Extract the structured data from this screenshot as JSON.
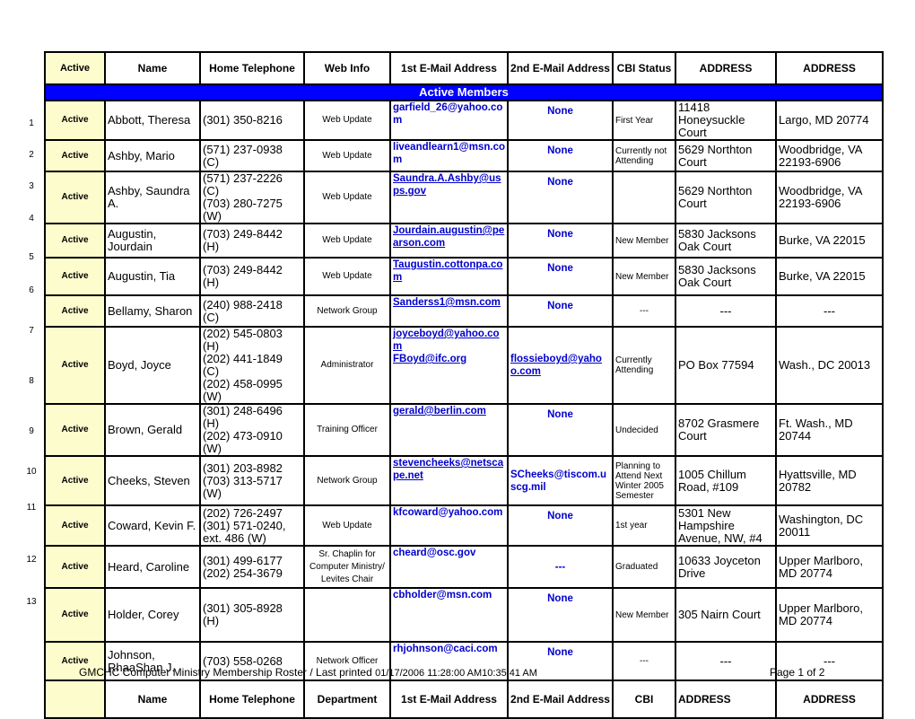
{
  "header": {
    "active": "Active",
    "name": "Name",
    "home_telephone": "Home Telephone",
    "web_info": "Web Info",
    "email1": "1st E-Mail Address",
    "email2": "2nd E-Mail Address",
    "cbi_status": "CBI Status",
    "address1": "ADDRESS",
    "address2": "ADDRESS"
  },
  "section_title": "Active Members",
  "rows": [
    {
      "num": "1",
      "active": "Active",
      "name": "Abbott, Theresa",
      "phone": "(301) 350-8216",
      "web": "Web Update",
      "email1": "garfield_26@yahoo.com",
      "email2": "None",
      "cbi": "First Year",
      "address1": "11418 Honeysuckle Court",
      "address2": "Largo, MD  20774"
    },
    {
      "num": "2",
      "active": "Active",
      "name": "Ashby, Mario",
      "phone": "(571) 237-0938 (C)",
      "web": "Web Update",
      "email1": "liveandlearn1@msn.com",
      "email2": "None",
      "cbi": "Currently not Attending",
      "address1": "5629 Northton Court",
      "address2": "Woodbridge, VA 22193-6906"
    },
    {
      "num": "3",
      "active": "Active",
      "name": "Ashby, Saundra A.",
      "phone": "(571) 237-2226 (C)\n(703) 280-7275 (W)",
      "web": "Web Update",
      "email1": "Saundra.A.Ashby@usps.gov",
      "email2": "None",
      "cbi": "",
      "address1": "5629 Northton Court",
      "address2": "Woodbridge, VA 22193-6906"
    },
    {
      "num": "4",
      "active": "Active",
      "name": "Augustin, Jourdain",
      "phone": "(703) 249-8442 (H)",
      "web": "Web Update",
      "email1": "Jourdain.augustin@pearson.com",
      "email2": "None",
      "cbi": "New Member",
      "address1": "5830 Jacksons Oak Court",
      "address2": "Burke, VA 22015"
    },
    {
      "num": "5",
      "active": "Active",
      "name": "Augustin, Tia",
      "phone": "(703) 249-8442 (H)",
      "web": "Web Update",
      "email1": "Taugustin.cottonpa.com",
      "email2": "None",
      "cbi": "New Member",
      "address1": "5830 Jacksons Oak Court",
      "address2": "Burke, VA 22015"
    },
    {
      "num": "6",
      "active": "Active",
      "name": "Bellamy, Sharon",
      "phone": "(240) 988-2418 (C)",
      "web": "Network Group",
      "email1": "Sanderss1@msn.com",
      "email2": "None",
      "cbi": "---",
      "address1": "---",
      "address2": "---"
    },
    {
      "num": "7",
      "active": "Active",
      "name": "Boyd, Joyce",
      "phone": "(202) 545-0803 (H)\n(202) 441-1849 (C)\n(202) 458-0995 (W)",
      "web": "Administrator",
      "email1": "joyceboyd@yahoo.com",
      "email1b": "FBoyd@ifc.org",
      "email2": "flossieboyd@yahoo.com",
      "cbi": "Currently Attending",
      "address1": "PO Box 77594",
      "address2": "Wash., DC 20013"
    },
    {
      "num": "8",
      "active": "Active",
      "name": "Brown, Gerald",
      "phone": "(301) 248-6496 (H)\n(202) 473-0910 (W)",
      "web": "Training Officer",
      "email1": "gerald@berlin.com",
      "email2": "None",
      "cbi": "Undecided",
      "address1": "8702 Grasmere Court",
      "address2": "Ft. Wash., MD 20744"
    },
    {
      "num": "9",
      "active": "Active",
      "name": "Cheeks, Steven",
      "phone": "(301) 203-8982\n(703) 313-5717 (W)",
      "web": "Network Group",
      "email1": "stevencheeks@netscape.net",
      "email2": "SCheeks@tiscom.uscg.mil",
      "cbi": "Planning to Attend Next Winter 2005 Semester",
      "address1": "1005 Chillum Road, #109",
      "address2": "Hyattsville, MD 20782"
    },
    {
      "num": "10",
      "active": "Active",
      "name": "Coward, Kevin F.",
      "phone": "(202) 726-2497\n(301) 571-0240, ext. 486 (W)",
      "web": "Web Update",
      "email1": "kfcoward@yahoo.com",
      "email2": "None",
      "cbi": "1st year",
      "address1": "5301 New Hampshire Avenue, NW, #4",
      "address2": "Washington, DC 20011"
    },
    {
      "num": "11",
      "active": "Active",
      "name": "Heard, Caroline",
      "phone": "(301) 499-6177\n(202) 254-3679",
      "web": "Sr. Chaplin for Computer Ministry/ Levites Chair",
      "email1": "cheard@osc.gov",
      "email2": "---",
      "cbi": "Graduated",
      "address1": "10633 Joyceton Drive",
      "address2": "Upper Marlboro, MD  20774"
    },
    {
      "num": "12",
      "active": "Active",
      "name": "Holder, Corey",
      "phone": "(301) 305-8928 (H)",
      "web": "",
      "email1": "cbholder@msn.com",
      "email2": "None",
      "cbi": "New Member",
      "address1": "305 Nairn Court",
      "address2": "Upper Marlboro, MD  20774"
    },
    {
      "num": "13",
      "active": "Active",
      "name": "Johnson, RhaaShan J.",
      "phone": "(703) 558-0268",
      "web": "Network Officer",
      "email1": "rhjohnson@caci.com",
      "email2": "None",
      "cbi": "---",
      "address1": "---",
      "address2": "---"
    }
  ],
  "footer_header": {
    "active": "",
    "name": "Name",
    "home_telephone": "Home Telephone",
    "department": "Department",
    "email1": "1st E-Mail Address",
    "email2": "2nd E-Mail Address",
    "cbi": "CBI",
    "address1": "ADDRESS",
    "address2": "ADDRESS"
  },
  "page_footer": {
    "title": "GMCHC Computer Ministry Membership Roster / Last printed ",
    "printed": "01/17/2006 11:28:00 AM10:35:41 AM",
    "page": "Page 1 of 2"
  },
  "colors": {
    "active_column_bg": "#fdfccd",
    "section_band": "#0000ff",
    "link": "#0000cc"
  }
}
